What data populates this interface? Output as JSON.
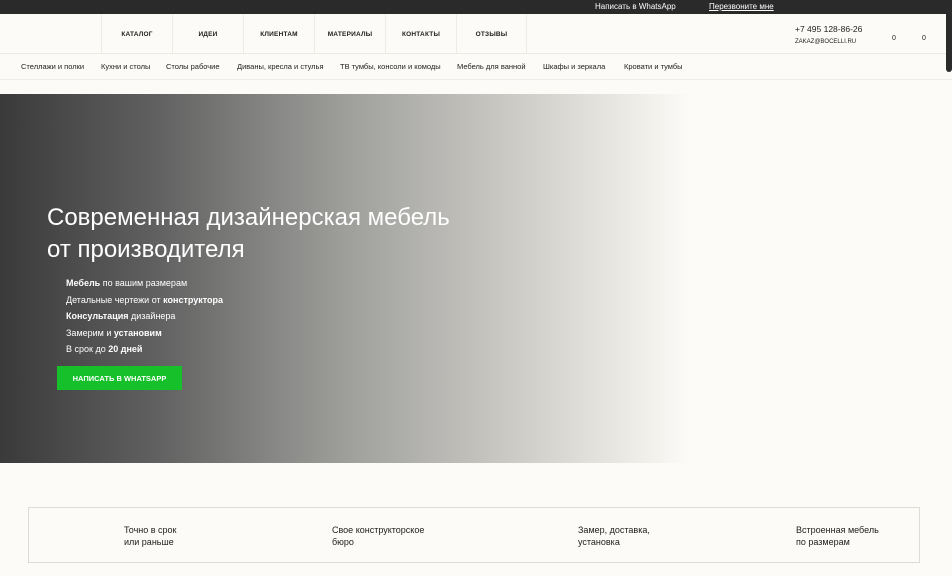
{
  "topbar": {
    "whatsapp_label": "Написать в WhatsApp",
    "callback_label": "Перезвоните мне"
  },
  "mainnav": {
    "items": [
      "КАТАЛОГ",
      "ИДЕИ",
      "КЛИЕНТАМ",
      "МАТЕРИАЛЫ",
      "КОНТАКТЫ",
      "ОТЗЫВЫ"
    ]
  },
  "contacts": {
    "phone": "+7 495 128-86-26",
    "email": "ZAKAZ@BOCELLI.RU"
  },
  "counters": {
    "favorites": "0",
    "cart": "0"
  },
  "catnav": {
    "items": [
      "Стеллажи и полки",
      "Кухни и столы",
      "Столы рабочие",
      "Диваны, кресла и стулья",
      "ТВ тумбы, консоли и комоды",
      "Мебель для ванной",
      "Шкафы и зеркала",
      "Кровати и тумбы"
    ]
  },
  "hero": {
    "title": "Современная дизайнерская мебель от производителя",
    "features": [
      {
        "bold": "Мебель",
        "rest": " по вашим размерам"
      },
      {
        "plain": "Детальные чертежи от ",
        "bold": "конструктора"
      },
      {
        "bold": "Консультация",
        "rest": " дизайнера"
      },
      {
        "plain": "Замерим и ",
        "bold": "установим"
      },
      {
        "plain": "В срок до ",
        "bold": "20 дней"
      }
    ],
    "cta_label": "НАПИСАТЬ В WHATSAPP"
  },
  "advantages": [
    "Точно в срок\nили раньше",
    "Свое конструкторское\nбюро",
    "Замер, доставка,\nустановка",
    "Встроенная мебель\nпо размерам"
  ]
}
